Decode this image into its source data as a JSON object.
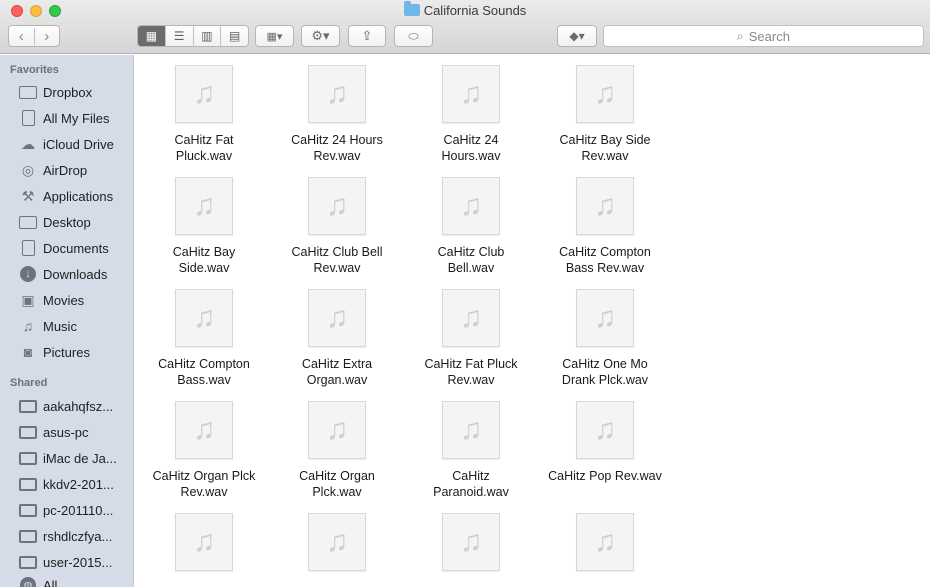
{
  "window": {
    "title": "California Sounds",
    "controls": {
      "close": "close",
      "minimize": "minimize",
      "maximize": "maximize"
    }
  },
  "toolbar": {
    "back_icon": "‹",
    "forward_icon": "›",
    "view_icons": [
      "▦",
      "☰",
      "▥",
      "▤"
    ],
    "arrange_icon": "▦▾",
    "action_icon": "⚙▾",
    "share_icon": "⇪",
    "tags_icon": "⬭",
    "dropbox_icon": "◆▾",
    "search_placeholder": "Search"
  },
  "sidebar": {
    "favorites_header": "Favorites",
    "favorites": [
      {
        "label": "Dropbox",
        "icon": "folder-icon"
      },
      {
        "label": "All My Files",
        "icon": "files-icon"
      },
      {
        "label": "iCloud Drive",
        "icon": "cloud-icon"
      },
      {
        "label": "AirDrop",
        "icon": "airdrop-icon"
      },
      {
        "label": "Applications",
        "icon": "applications-icon"
      },
      {
        "label": "Desktop",
        "icon": "desktop-icon"
      },
      {
        "label": "Documents",
        "icon": "documents-icon"
      },
      {
        "label": "Downloads",
        "icon": "downloads-icon"
      },
      {
        "label": "Movies",
        "icon": "movies-icon"
      },
      {
        "label": "Music",
        "icon": "music-icon"
      },
      {
        "label": "Pictures",
        "icon": "pictures-icon"
      }
    ],
    "shared_header": "Shared",
    "shared": [
      {
        "label": "aakahqfsz...",
        "icon": "computer-icon"
      },
      {
        "label": "asus-pc",
        "icon": "computer-icon"
      },
      {
        "label": "iMac de Ja...",
        "icon": "computer-icon"
      },
      {
        "label": "kkdv2-201...",
        "icon": "computer-icon"
      },
      {
        "label": "pc-201110...",
        "icon": "computer-icon"
      },
      {
        "label": "rshdlczfya...",
        "icon": "computer-icon"
      },
      {
        "label": "user-2015...",
        "icon": "computer-icon"
      },
      {
        "label": "All...",
        "icon": "globe-icon"
      }
    ]
  },
  "files": [
    {
      "name": "CaHitz  Fat\nPluck.wav"
    },
    {
      "name": "CaHitz 24 Hours\nRev.wav"
    },
    {
      "name": "CaHitz 24\nHours.wav"
    },
    {
      "name": "CaHitz Bay Side\nRev.wav"
    },
    {
      "name": "CaHitz Bay\nSide.wav"
    },
    {
      "name": "CaHitz Club Bell\nRev.wav"
    },
    {
      "name": "CaHitz Club\nBell.wav"
    },
    {
      "name": "CaHitz Compton\nBass Rev.wav"
    },
    {
      "name": "CaHitz Compton\nBass.wav"
    },
    {
      "name": "CaHitz Extra\nOrgan.wav"
    },
    {
      "name": "CaHitz Fat Pluck\nRev.wav"
    },
    {
      "name": "CaHitz One Mo\nDrank Plck.wav"
    },
    {
      "name": "CaHitz Organ Plck\nRev.wav"
    },
    {
      "name": "CaHitz Organ\nPlck.wav"
    },
    {
      "name": "CaHitz\nParanoid.wav"
    },
    {
      "name": "CaHitz Pop Rev.wav"
    },
    {
      "name": ""
    },
    {
      "name": ""
    },
    {
      "name": ""
    },
    {
      "name": ""
    }
  ],
  "file_icon": "♫"
}
